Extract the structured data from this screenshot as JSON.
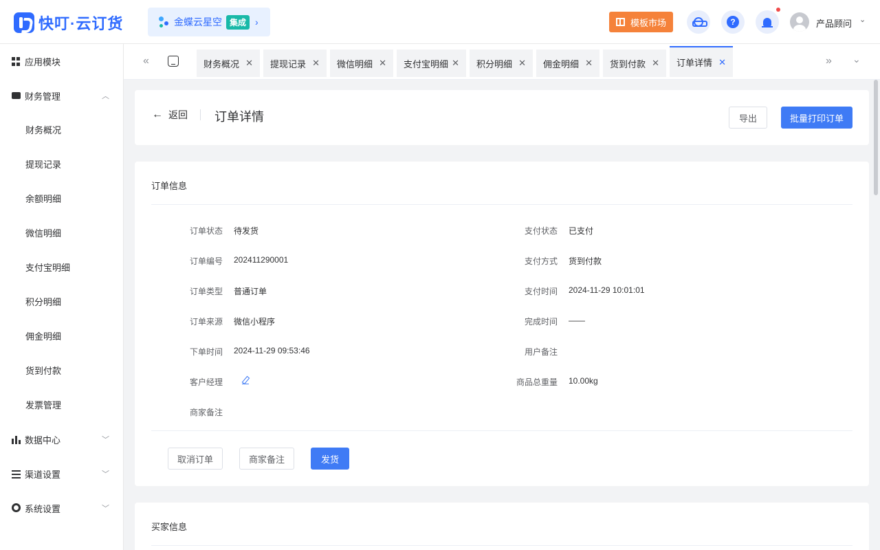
{
  "header": {
    "logo_text": "快叮·云订货",
    "kingdee": {
      "text": "金蝶云星空",
      "tag": "集成"
    },
    "template_market": "模板市场",
    "user_name": "产品顾问"
  },
  "sidebar": {
    "items": [
      {
        "label": "应用模块"
      },
      {
        "label": "财务管理"
      },
      {
        "label": "财务概况"
      },
      {
        "label": "提现记录"
      },
      {
        "label": "余额明细"
      },
      {
        "label": "微信明细"
      },
      {
        "label": "支付宝明细"
      },
      {
        "label": "积分明细"
      },
      {
        "label": "佣金明细"
      },
      {
        "label": "货到付款"
      },
      {
        "label": "发票管理"
      },
      {
        "label": "数据中心"
      },
      {
        "label": "渠道设置"
      },
      {
        "label": "系统设置"
      }
    ]
  },
  "tabs": [
    {
      "label": "财务概况"
    },
    {
      "label": "提现记录"
    },
    {
      "label": "微信明细"
    },
    {
      "label": "支付宝明细"
    },
    {
      "label": "积分明细"
    },
    {
      "label": "佣金明细"
    },
    {
      "label": "货到付款"
    },
    {
      "label": "订单详情",
      "active": true
    }
  ],
  "page": {
    "back_label": "返回",
    "title": "订单详情",
    "export_label": "导出",
    "batch_print_label": "批量打印订单"
  },
  "order_info": {
    "title": "订单信息",
    "left": [
      {
        "label": "订单状态",
        "value": "待发货"
      },
      {
        "label": "订单编号",
        "value": "202411290001"
      },
      {
        "label": "订单类型",
        "value": "普通订单"
      },
      {
        "label": "订单来源",
        "value": "微信小程序"
      },
      {
        "label": "下单时间",
        "value": "2024-11-29 09:53:46"
      },
      {
        "label": "客户经理",
        "value": ""
      },
      {
        "label": "商家备注",
        "value": ""
      }
    ],
    "right": [
      {
        "label": "支付状态",
        "value": "已支付"
      },
      {
        "label": "支付方式",
        "value": "货到付款"
      },
      {
        "label": "支付时间",
        "value": "2024-11-29 10:01:01"
      },
      {
        "label": "完成时间",
        "value": "——"
      },
      {
        "label": "用户备注",
        "value": ""
      },
      {
        "label": "商品总重量",
        "value": "10.00kg"
      }
    ],
    "actions": {
      "cancel_label": "取消订单",
      "note_label": "商家备注",
      "ship_label": "发货"
    }
  },
  "buyer_info": {
    "title": "买家信息"
  },
  "colors": {
    "primary": "#3f7bf5",
    "brand": "#2f6bff",
    "orange": "#f5823a",
    "teal": "#19b9a8"
  }
}
